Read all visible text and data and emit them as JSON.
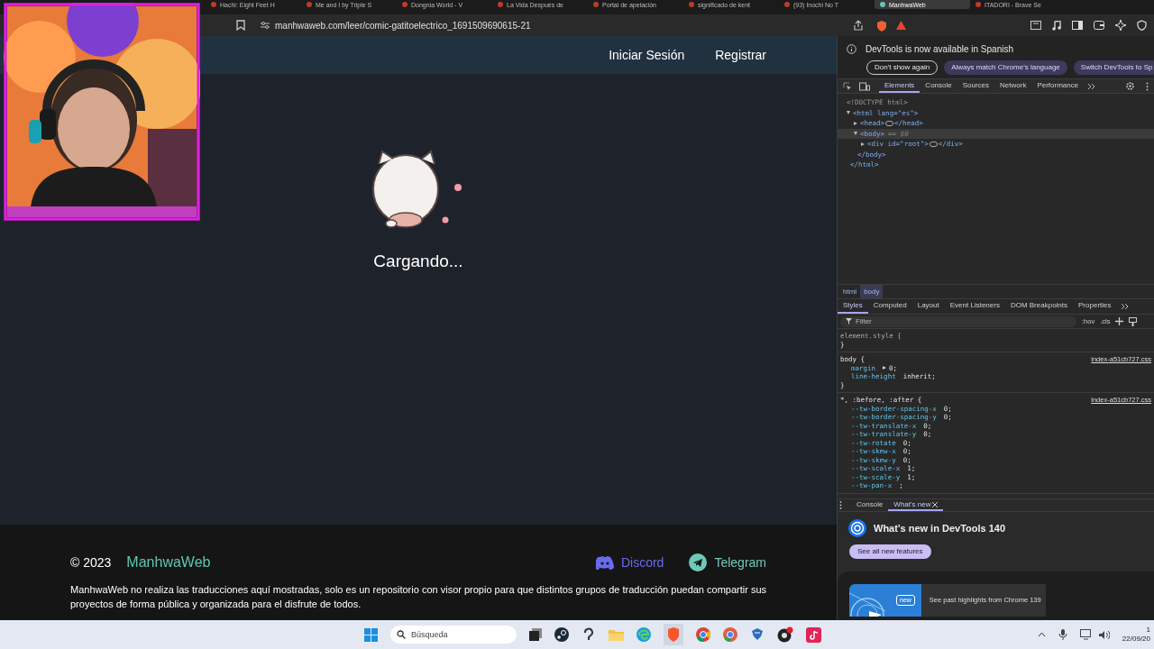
{
  "browser": {
    "tabs": [
      {
        "title": "Hachi: Eight Feet H",
        "selected": false
      },
      {
        "title": "Me and I by Triple S",
        "selected": false
      },
      {
        "title": "Dongnia World - V",
        "selected": false
      },
      {
        "title": "La Vida Después de",
        "selected": false
      },
      {
        "title": "Portal de apelación",
        "selected": false
      },
      {
        "title": "significado de kent",
        "selected": false
      },
      {
        "title": "(93) Inochi No T",
        "selected": false
      },
      {
        "title": "ManhwaWeb",
        "selected": true
      },
      {
        "title": "ITADORI - Brave Se",
        "selected": false
      }
    ],
    "address_bar": {
      "url": "manhwaweb.com/leer/comic-gatitoelectrico_1691509690615-21"
    }
  },
  "page": {
    "nav": [
      {
        "label": "Iniciar Sesión"
      },
      {
        "label": "Registrar"
      }
    ],
    "loading": {
      "text": "Cargando..."
    },
    "footer": {
      "copyright": "© 2023",
      "brand": "ManhwaWeb",
      "links": [
        {
          "label": "Discord",
          "kind": "discord"
        },
        {
          "label": "Telegram",
          "kind": "telegram"
        }
      ],
      "disclaimer": "ManhwaWeb no realiza las traducciones aquí mostradas, solo es un repositorio con visor propio para que distintos grupos de traducción puedan compartir sus proyectos de forma pública y organizada para el disfrute de todos."
    }
  },
  "devtools": {
    "infobar": {
      "message": "DevTools is now available in Spanish",
      "buttons": [
        {
          "label": "Don't show again",
          "kind": "outline"
        },
        {
          "label": "Always match Chrome's language",
          "kind": "filled"
        },
        {
          "label": "Switch DevTools to Sp",
          "kind": "filled"
        }
      ]
    },
    "tabs": [
      {
        "label": "Elements",
        "selected": true
      },
      {
        "label": "Console",
        "selected": false
      },
      {
        "label": "Sources",
        "selected": false
      },
      {
        "label": "Network",
        "selected": false
      },
      {
        "label": "Performance",
        "selected": false
      }
    ],
    "dom": [
      {
        "open": "<!DOCTYPE html>",
        "kind": "doctype"
      },
      {
        "open": "<html lang=\"es\">",
        "close": "</html>",
        "expanded": true,
        "children": [
          {
            "open": "<head>",
            "close": "</head>",
            "expanded": false
          },
          {
            "open": "<body>",
            "note": "== $0",
            "close": "</body>",
            "expanded": true,
            "selected": true,
            "children": [
              {
                "open": "<div id=\"root\">",
                "close": "</div>",
                "expanded": false
              }
            ]
          }
        ]
      }
    ],
    "breadcrumbs": [
      {
        "label": "html",
        "selected": false
      },
      {
        "label": "body",
        "selected": true
      }
    ],
    "style_tabs": [
      {
        "label": "Styles",
        "selected": true
      },
      {
        "label": "Computed",
        "selected": false
      },
      {
        "label": "Layout",
        "selected": false
      },
      {
        "label": "Event Listeners",
        "selected": false
      },
      {
        "label": "DOM Breakpoints",
        "selected": false
      },
      {
        "label": "Properties",
        "selected": false
      }
    ],
    "filter": {
      "placeholder": "Filter"
    },
    "filter_buttons": [
      ":hov",
      ".cls"
    ],
    "rules": [
      {
        "selector": "element.style {",
        "close": "}"
      },
      {
        "selector": "body {",
        "source": "index-a51cb727.css",
        "close": "}",
        "declarations": [
          {
            "property": "margin",
            "value": "0;",
            "expandable": true
          },
          {
            "property": "line-height",
            "value": "inherit;"
          }
        ]
      },
      {
        "selector": "*, :before, :after {",
        "source": "index-a51cb727.css",
        "declarations": [
          {
            "property": "--tw-border-spacing-x",
            "value": "0;"
          },
          {
            "property": "--tw-border-spacing-y",
            "value": "0;"
          },
          {
            "property": "--tw-translate-x",
            "value": "0;"
          },
          {
            "property": "--tw-translate-y",
            "value": "0;"
          },
          {
            "property": "--tw-rotate",
            "value": "0;"
          },
          {
            "property": "--tw-skew-x",
            "value": "0;"
          },
          {
            "property": "--tw-skew-y",
            "value": "0;"
          },
          {
            "property": "--tw-scale-x",
            "value": "1;"
          },
          {
            "property": "--tw-scale-y",
            "value": "1;"
          },
          {
            "property": "--tw-pan-x",
            "value": ";"
          }
        ]
      }
    ],
    "drawer": {
      "tabs": [
        {
          "label": "Console",
          "selected": false,
          "closable": false
        },
        {
          "label": "What's new",
          "selected": true,
          "closable": true
        }
      ],
      "whats_new": {
        "title": "What's new in DevTools 140",
        "button": "See all new features",
        "badge": "new",
        "card_text": "See past highlights from Chrome 139"
      }
    }
  },
  "taskbar": {
    "search": {
      "placeholder": "Búsqueda"
    },
    "clock": {
      "time": "1",
      "date": "22/09/20"
    }
  }
}
